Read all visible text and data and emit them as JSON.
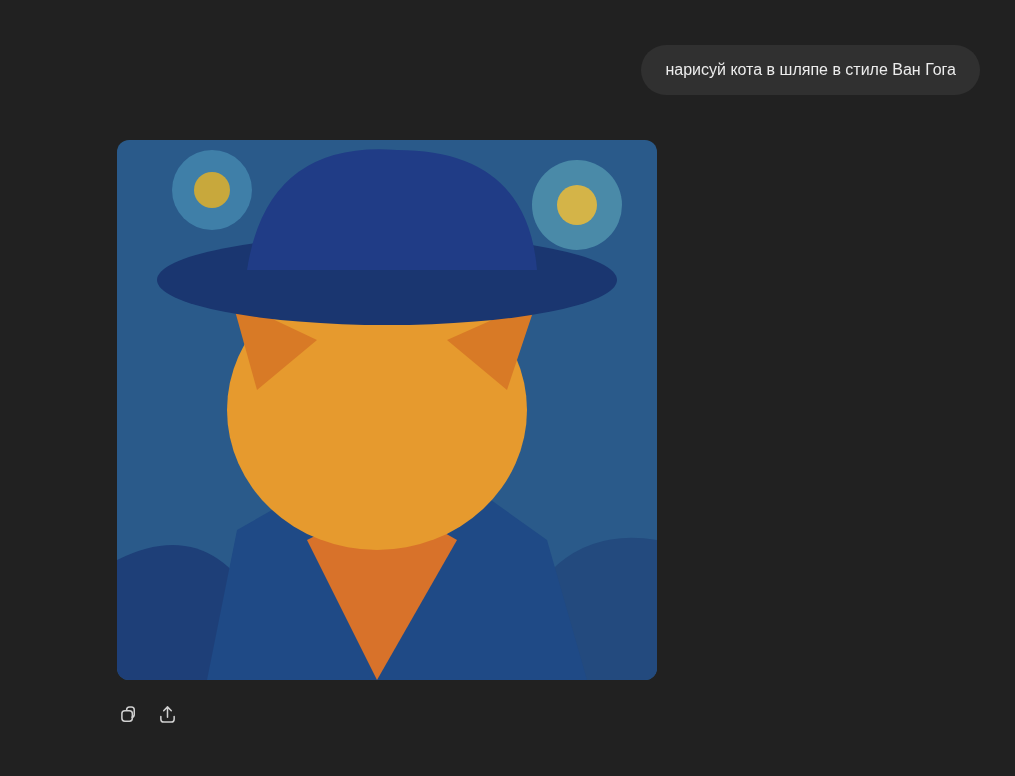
{
  "user_message": {
    "text": "нарисуй кота в шляпе в стиле Ван Гога"
  }
}
